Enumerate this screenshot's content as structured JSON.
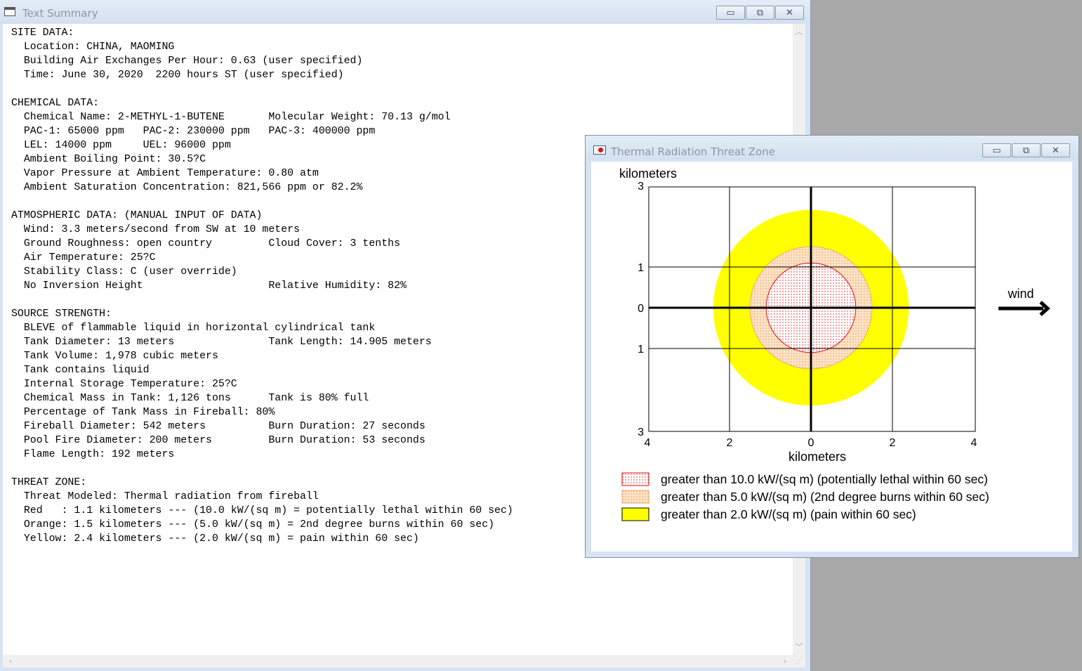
{
  "text_summary_window": {
    "title": "Text Summary",
    "lines": [
      "SITE DATA:",
      "  Location: CHINA, MAOMING",
      "  Building Air Exchanges Per Hour: 0.63 (user specified)",
      "  Time: June 30, 2020  2200 hours ST (user specified)",
      "",
      "CHEMICAL DATA:",
      "  Chemical Name: 2-METHYL-1-BUTENE       Molecular Weight: 70.13 g/mol",
      "  PAC-1: 65000 ppm   PAC-2: 230000 ppm   PAC-3: 400000 ppm",
      "  LEL: 14000 ppm     UEL: 96000 ppm",
      "  Ambient Boiling Point: 30.5?C",
      "  Vapor Pressure at Ambient Temperature: 0.80 atm",
      "  Ambient Saturation Concentration: 821,566 ppm or 82.2%",
      "",
      "ATMOSPHERIC DATA: (MANUAL INPUT OF DATA)",
      "  Wind: 3.3 meters/second from SW at 10 meters",
      "  Ground Roughness: open country         Cloud Cover: 3 tenths",
      "  Air Temperature: 25?C",
      "  Stability Class: C (user override)",
      "  No Inversion Height                    Relative Humidity: 82%",
      "",
      "SOURCE STRENGTH:",
      "  BLEVE of flammable liquid in horizontal cylindrical tank",
      "  Tank Diameter: 13 meters               Tank Length: 14.905 meters",
      "  Tank Volume: 1,978 cubic meters",
      "  Tank contains liquid",
      "  Internal Storage Temperature: 25?C",
      "  Chemical Mass in Tank: 1,126 tons      Tank is 80% full",
      "  Percentage of Tank Mass in Fireball: 80%",
      "  Fireball Diameter: 542 meters          Burn Duration: 27 seconds",
      "  Pool Fire Diameter: 200 meters         Burn Duration: 53 seconds",
      "  Flame Length: 192 meters",
      "",
      "THREAT ZONE:",
      "  Threat Modeled: Thermal radiation from fireball",
      "  Red   : 1.1 kilometers --- (10.0 kW/(sq m) = potentially lethal within 60 sec)",
      "  Orange: 1.5 kilometers --- (5.0 kW/(sq m) = 2nd degree burns within 60 sec)",
      "  Yellow: 2.4 kilometers --- (2.0 kW/(sq m) = pain within 60 sec)"
    ]
  },
  "threat_zone_window": {
    "title": "Thermal Radiation Threat Zone",
    "window_controls": {
      "minimize": "▭",
      "restore": "⧉",
      "close": "✕"
    }
  },
  "chart_data": {
    "type": "threat-zone-circles",
    "ylabel": "kilometers",
    "xlabel": "kilometers",
    "xlim": [
      -4,
      4
    ],
    "ylim": [
      -3,
      3
    ],
    "x_ticks": [
      {
        "value": -4,
        "label": "4"
      },
      {
        "value": -2,
        "label": "2"
      },
      {
        "value": 0,
        "label": "0"
      },
      {
        "value": 2,
        "label": "2"
      },
      {
        "value": 4,
        "label": "4"
      }
    ],
    "y_ticks": [
      {
        "value": 3,
        "label": "3"
      },
      {
        "value": 1,
        "label": "1"
      },
      {
        "value": 0,
        "label": "0"
      },
      {
        "value": -1,
        "label": "1"
      },
      {
        "value": -3,
        "label": "3"
      }
    ],
    "grid": true,
    "wind_label": "wind",
    "wind_direction": "right",
    "zones": [
      {
        "radius_km": 2.4,
        "color": "#ffff00",
        "pattern": "solid",
        "legend": "greater than 2.0 kW/(sq m) (pain within 60 sec)"
      },
      {
        "radius_km": 1.5,
        "color": "#f5c89a",
        "pattern": "dots",
        "legend": "greater than 5.0 kW/(sq m) (2nd degree burns within 60 sec)"
      },
      {
        "radius_km": 1.1,
        "color": "#e01010",
        "pattern": "dots",
        "legend": "greater than 10.0 kW/(sq m) (potentially lethal within 60 sec)"
      }
    ]
  }
}
